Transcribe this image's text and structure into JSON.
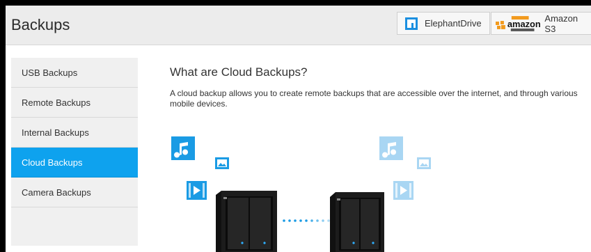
{
  "header": {
    "title": "Backups",
    "providers": [
      {
        "label": "ElephantDrive",
        "icon": "elephantdrive-icon"
      },
      {
        "label": "Amazon S3",
        "icon": "amazon-web-services-logo",
        "logo_text": "amazon"
      }
    ]
  },
  "sidebar": {
    "items": [
      {
        "label": "USB Backups",
        "active": false
      },
      {
        "label": "Remote Backups",
        "active": false
      },
      {
        "label": "Internal Backups",
        "active": false
      },
      {
        "label": "Cloud Backups",
        "active": true
      },
      {
        "label": "Camera Backups",
        "active": false
      }
    ]
  },
  "main": {
    "title": "What are Cloud Backups?",
    "description": "A cloud backup allows you to create remote backups that are accessible over the internet, and through various mobile devices."
  },
  "colors": {
    "accent": "#0ea2ee",
    "media_icon": "#1a9be4",
    "media_icon_faded": "#a9d6f3"
  }
}
